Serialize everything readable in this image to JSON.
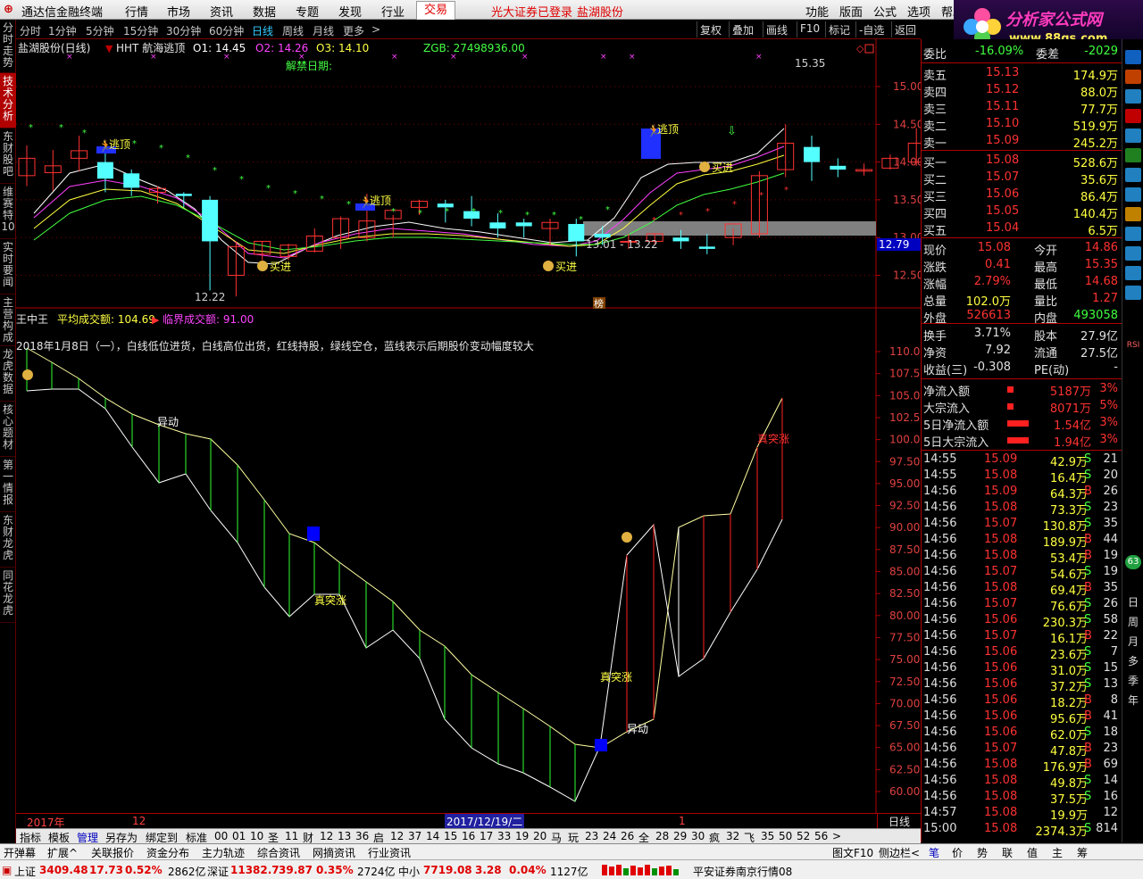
{
  "menubar": {
    "app": "通达信金融终端",
    "items": [
      "行情",
      "市场",
      "资讯",
      "数据",
      "专题",
      "发现",
      "行业",
      "交易"
    ],
    "active": "交易",
    "login": "光大证券已登录",
    "stock": "盐湖股份",
    "right": [
      "功能",
      "版面",
      "公式",
      "选项",
      "帮助"
    ]
  },
  "logo": {
    "title": "分析家公式网",
    "url": "www.88gs.com"
  },
  "left_tabs": [
    "分时走势",
    "技术分析",
    "东财股吧",
    "维赛特10",
    "实时要闻",
    "主营构成",
    "龙虎数据",
    "核心题材",
    "第一情报",
    "东财龙虎",
    "同花龙虎"
  ],
  "period_bar": {
    "items": [
      "分时",
      "1分钟",
      "5分钟",
      "15分钟",
      "30分钟",
      "60分钟",
      "日线",
      "周线",
      "月线",
      "更多",
      ">"
    ],
    "selected": "日线",
    "buttons": [
      "复权",
      "叠加",
      "画线",
      "F10",
      "标记",
      "-自选",
      "返回"
    ]
  },
  "main_chart": {
    "title": "盐湖股份(日线)",
    "indicator": "HHT 航海逃顶",
    "o1": "O1: 14.45",
    "o2": "O2: 14.26",
    "o3": "O3: 14.10",
    "zgb": "ZGB: 27498936.00",
    "jiejin": "解禁日期:",
    "y_ticks": [
      "15.00",
      "14.50",
      "14.00",
      "13.50",
      "13.00",
      "12.50"
    ],
    "current_price_tag": "12.79",
    "high_label": "15.35",
    "low_label": "12.22",
    "range_label": "13.01 - 13.22",
    "bang_label": "榜",
    "escape_label": "逃顶",
    "buy_label": "买进"
  },
  "sub_chart": {
    "title": "王中王",
    "avg_volume": "平均成交额: 104.69",
    "critical_volume": "临界成交额: 91.00",
    "note": "2018年1月8日（一），白线低位进货，白线高位出货，红线持股，绿线空仓，蓝线表示后期股价变动幅度较大",
    "y_ticks": [
      "110.0",
      "107.5",
      "105.0",
      "102.5",
      "100.0",
      "97.50",
      "95.00",
      "92.50",
      "90.00",
      "87.50",
      "85.00",
      "82.50",
      "80.00",
      "77.50",
      "75.00",
      "72.50",
      "70.00",
      "67.50",
      "65.00",
      "62.50",
      "60.00"
    ],
    "labels": {
      "yidong1": "异动",
      "zhentu1": "真突涨",
      "zhentu2": "真突涨",
      "yidong2": "异动",
      "zhentu3": "真突涨"
    }
  },
  "x_axis": {
    "year": "2017年",
    "month": "12",
    "cursor_date": "2017/12/19/二",
    "next_month": "1",
    "period_tag": "日线"
  },
  "bottom_tabs": [
    "指标",
    "模板",
    "管理",
    "另存为",
    "绑定到",
    "标准",
    "00",
    "01",
    "10",
    "圣",
    "11",
    "财",
    "12",
    "13",
    "36",
    "启",
    "12",
    "37",
    "14",
    "15",
    "16",
    "17",
    "33",
    "19",
    "20",
    "马",
    "玩",
    "23",
    "24",
    "26",
    "全",
    "28",
    "29",
    "30",
    "疯",
    "32",
    "飞",
    "35",
    "50",
    "52",
    "56",
    ">"
  ],
  "bottom_tabs_selected": "管理",
  "news_tabs": [
    "开弹幕",
    "扩展^",
    "关联报价",
    "资金分布",
    "主力轨迹",
    "综合资讯",
    "网摘资讯",
    "行业资讯"
  ],
  "news_right": [
    "图文F10",
    "侧边栏<",
    "笔",
    "价",
    "势",
    "联",
    "值",
    "主",
    "筹"
  ],
  "quote": {
    "weibi_label": "委比",
    "weibi": "-16.09%",
    "weicha_label": "委差",
    "weicha": "-2029",
    "asks": [
      {
        "label": "卖五",
        "price": "15.13",
        "vol": "174.9万"
      },
      {
        "label": "卖四",
        "price": "15.12",
        "vol": "88.0万"
      },
      {
        "label": "卖三",
        "price": "15.11",
        "vol": "77.7万"
      },
      {
        "label": "卖二",
        "price": "15.10",
        "vol": "519.9万"
      },
      {
        "label": "卖一",
        "price": "15.09",
        "vol": "245.2万"
      }
    ],
    "bids": [
      {
        "label": "买一",
        "price": "15.08",
        "vol": "528.6万"
      },
      {
        "label": "买二",
        "price": "15.07",
        "vol": "35.6万"
      },
      {
        "label": "买三",
        "price": "15.06",
        "vol": "86.4万"
      },
      {
        "label": "买四",
        "price": "15.05",
        "vol": "140.4万"
      },
      {
        "label": "买五",
        "price": "15.04",
        "vol": "6.5万"
      }
    ],
    "stats": [
      {
        "l1": "现价",
        "v1": "15.08",
        "l2": "今开",
        "v2": "14.86"
      },
      {
        "l1": "涨跌",
        "v1": "0.41",
        "l2": "最高",
        "v2": "15.35"
      },
      {
        "l1": "涨幅",
        "v1": "2.79%",
        "l2": "最低",
        "v2": "14.68"
      },
      {
        "l1": "总量",
        "v1": "102.0万",
        "l2": "量比",
        "v2": "1.27"
      },
      {
        "l1": "外盘",
        "v1": "526613",
        "l2": "内盘",
        "v2": "493058"
      }
    ],
    "stats2": [
      {
        "l1": "换手",
        "v1": "3.71%",
        "l2": "股本",
        "v2": "27.9亿"
      },
      {
        "l1": "净资",
        "v1": "7.92",
        "l2": "流通",
        "v2": "27.5亿"
      },
      {
        "l1": "收益(三)",
        "v1": "-0.308",
        "l2": "PE(动)",
        "v2": "-"
      }
    ],
    "flows": [
      {
        "label": "净流入额",
        "value": "5187万",
        "pct": "3%"
      },
      {
        "label": "大宗流入",
        "value": "8071万",
        "pct": "5%"
      },
      {
        "label": "5日净流入额",
        "value": "1.54亿",
        "pct": "3%"
      },
      {
        "label": "5日大宗流入",
        "value": "1.94亿",
        "pct": "3%"
      }
    ],
    "ticks": [
      {
        "t": "14:55",
        "p": "15.09",
        "v": "42.9万",
        "s": "S",
        "n": "21"
      },
      {
        "t": "14:55",
        "p": "15.08",
        "v": "16.4万",
        "s": "S",
        "n": "20"
      },
      {
        "t": "14:56",
        "p": "15.09",
        "v": "64.3万",
        "s": "B",
        "n": "26"
      },
      {
        "t": "14:56",
        "p": "15.08",
        "v": "73.3万",
        "s": "S",
        "n": "23"
      },
      {
        "t": "14:56",
        "p": "15.07",
        "v": "130.8万",
        "s": "S",
        "n": "35"
      },
      {
        "t": "14:56",
        "p": "15.08",
        "v": "189.9万",
        "s": "B",
        "n": "44"
      },
      {
        "t": "14:56",
        "p": "15.08",
        "v": "53.4万",
        "s": "B",
        "n": "19"
      },
      {
        "t": "14:56",
        "p": "15.07",
        "v": "54.6万",
        "s": "S",
        "n": "19"
      },
      {
        "t": "14:56",
        "p": "15.08",
        "v": "69.4万",
        "s": "B",
        "n": "35"
      },
      {
        "t": "14:56",
        "p": "15.07",
        "v": "76.6万",
        "s": "S",
        "n": "26"
      },
      {
        "t": "14:56",
        "p": "15.06",
        "v": "230.3万",
        "s": "S",
        "n": "58"
      },
      {
        "t": "14:56",
        "p": "15.07",
        "v": "16.1万",
        "s": "B",
        "n": "22"
      },
      {
        "t": "14:56",
        "p": "15.06",
        "v": "23.6万",
        "s": "S",
        "n": "7"
      },
      {
        "t": "14:56",
        "p": "15.06",
        "v": "31.0万",
        "s": "S",
        "n": "15"
      },
      {
        "t": "14:56",
        "p": "15.06",
        "v": "37.2万",
        "s": "S",
        "n": "13"
      },
      {
        "t": "14:56",
        "p": "15.06",
        "v": "18.2万",
        "s": "B",
        "n": "8"
      },
      {
        "t": "14:56",
        "p": "15.06",
        "v": "95.6万",
        "s": "B",
        "n": "41"
      },
      {
        "t": "14:56",
        "p": "15.06",
        "v": "62.0万",
        "s": "S",
        "n": "18"
      },
      {
        "t": "14:56",
        "p": "15.07",
        "v": "47.8万",
        "s": "B",
        "n": "23"
      },
      {
        "t": "14:56",
        "p": "15.08",
        "v": "176.9万",
        "s": "B",
        "n": "69"
      },
      {
        "t": "14:56",
        "p": "15.08",
        "v": "49.8万",
        "s": "S",
        "n": "14"
      },
      {
        "t": "14:56",
        "p": "15.08",
        "v": "37.5万",
        "s": "S",
        "n": "16"
      },
      {
        "t": "14:57",
        "p": "15.08",
        "v": "19.9万",
        "s": "",
        "n": "12"
      },
      {
        "t": "15:00",
        "p": "15.08",
        "v": "2374.3万",
        "s": "S",
        "n": "814"
      }
    ]
  },
  "right_icons": [
    "RSI",
    "63",
    "日",
    "周",
    "月",
    "多",
    "季",
    "年"
  ],
  "status": {
    "sh_label": "上证",
    "sh": "3409.48",
    "sh_chg": "17.73",
    "sh_pct": "0.52%",
    "sh_amt": "2862亿",
    "sz_label": "深证",
    "sz": "11382.7",
    "sz_chg": "39.87",
    "sz_pct": "0.35%",
    "sz_amt": "2724亿",
    "zx_label": "中小",
    "zx": "7719.08",
    "zx_chg": "3.28",
    "zx_pct": "0.04%",
    "zx_amt": "1127亿",
    "broker": "平安证券南京行情08"
  },
  "colors": {
    "up": "#ff3232",
    "down": "#54ffff",
    "panel_red": "#b00000",
    "yellow": "#ffff00"
  }
}
